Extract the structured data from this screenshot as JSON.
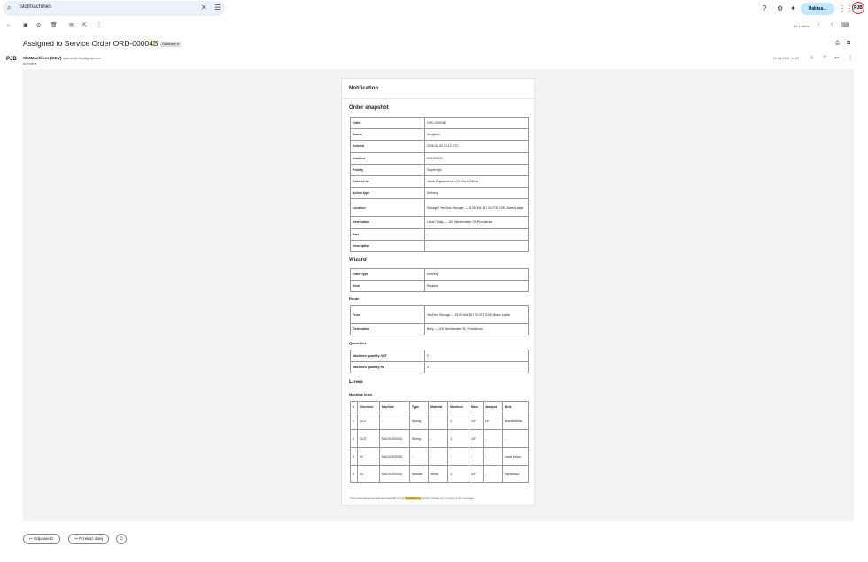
{
  "search": {
    "query": "slotmachines"
  },
  "header": {
    "upgrade_label": "Uaktua...",
    "avatar_text": "PJB"
  },
  "toolbar": {
    "pager": "15 z wielu"
  },
  "email": {
    "subject": "Assigned to Service Order ORD-00004B",
    "label": "Odebrane",
    "sender_name": "SlotMachines (DEV)",
    "sender_email": "<patches@ofdea@gmail.com>",
    "to": "do mnie",
    "date": "21 sty 2026, 14:20",
    "avatar_text": "PJB"
  },
  "card": {
    "title": "Notification",
    "snapshot_title": "Order snapshot",
    "snapshot": [
      {
        "k": "Order",
        "v": "ORD-00004B"
      },
      {
        "k": "Status",
        "v": "Assigned"
      },
      {
        "k": "Entered",
        "v": "2026-01-09 20:12 UTC"
      },
      {
        "k": "Deadline",
        "v": "01/13/2026"
      },
      {
        "k": "Priority",
        "v": "SuperHigh"
      },
      {
        "k": "Ordered by",
        "v": "Jacek Bogdankenko (YesTech Office)"
      },
      {
        "k": "Action type",
        "v": "Delivery"
      },
      {
        "k": "Location",
        "v": "Storage / YesTech Storage — 5135 NW 167 St STE E28, Miami Lakes"
      },
      {
        "k": "Destination",
        "v": "Local / Bally — 100 Westminster St, Providence"
      },
      {
        "k": "Part",
        "v": "-"
      },
      {
        "k": "Description",
        "v": "-"
      }
    ],
    "wizard_title": "Wizard",
    "wizard": [
      {
        "k": "Order type",
        "v": "Delivery"
      },
      {
        "k": "Kind",
        "v": "Replace"
      }
    ],
    "route_title": "Route",
    "route": [
      {
        "k": "From",
        "v": "YesTech Storage — 5135 NW 167 St STE E28, Miami Lakes"
      },
      {
        "k": "Destination",
        "v": "Bally — 100 Westminster St, Providence"
      }
    ],
    "quantities_title": "Quantities",
    "quantities": [
      {
        "k": "Machines quantity OUT",
        "v": "2"
      },
      {
        "k": "Machines quantity IN",
        "v": "2"
      }
    ],
    "lines_title": "Lines",
    "machine_lines_title": "Machine lines",
    "line_headers": [
      "#",
      "Direction",
      "Machine",
      "Type",
      "Material",
      "Monitors",
      "Main",
      "Jackpot",
      "Note"
    ],
    "lines": [
      [
        "1",
        "OUT",
        "-",
        "Skinny",
        "-",
        "2",
        "15\"",
        "15\"",
        "ta amazłona"
      ],
      [
        "2",
        "OUT",
        "MACH-000004",
        "Skinny",
        "-",
        "1",
        "15\"",
        "-",
        "-"
      ],
      [
        "3",
        "IN",
        "MACH-000005",
        "-",
        "-",
        "-",
        "-",
        "-",
        "nowa ładna"
      ],
      [
        "4",
        "IN",
        "MACH-000004",
        "Sitdown",
        "metal",
        "1",
        "43\"",
        "-",
        "najnowsza"
      ]
    ],
    "footer_pre": "This email was generated automatically by the",
    "footer_hl": "SlotMachines",
    "footer_post": "system. Please do not reply to this message."
  },
  "actions": {
    "reply": "Odpowiedz",
    "forward": "Przekaż dalej"
  }
}
